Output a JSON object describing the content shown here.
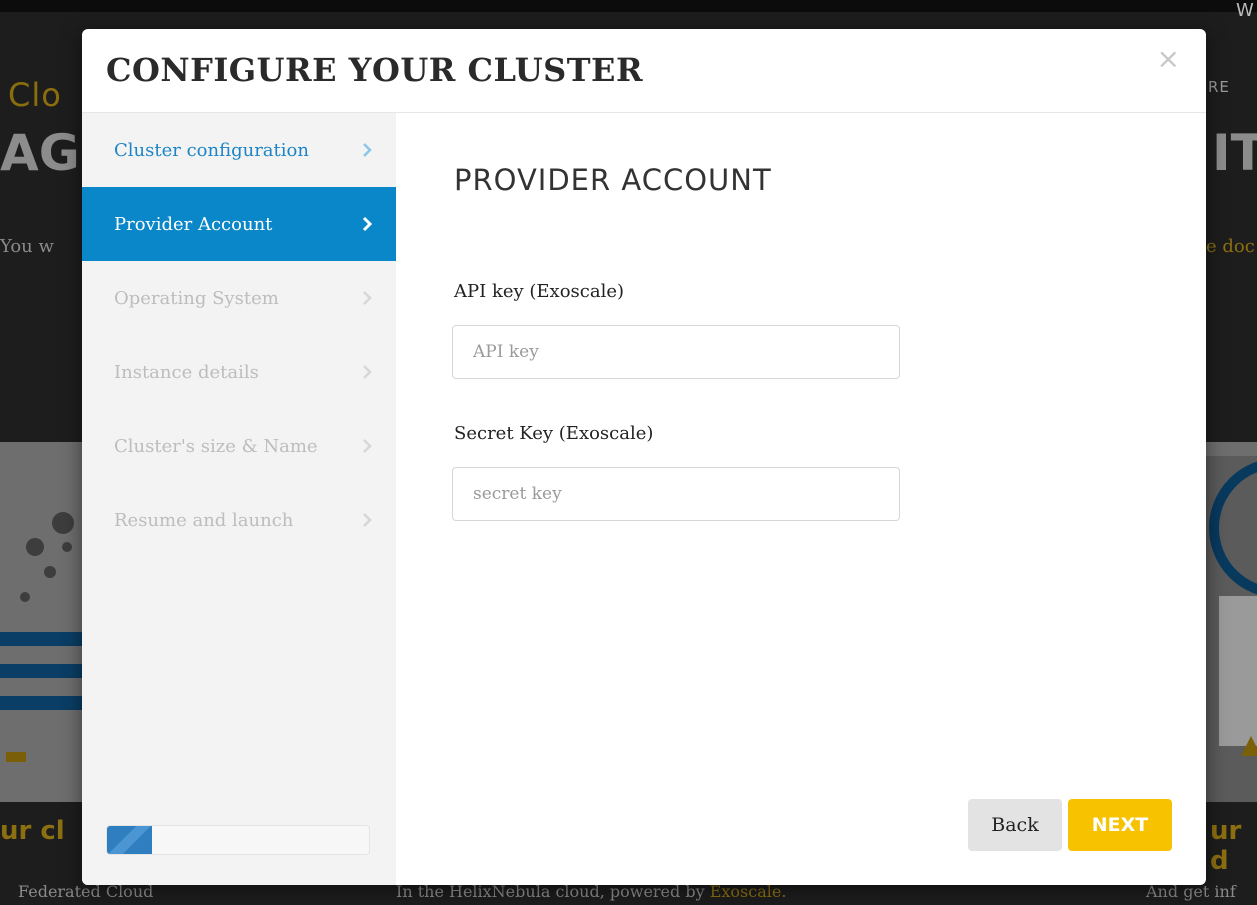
{
  "background": {
    "brand_fragment": "Clo",
    "nav_fragment_top": "W",
    "nav_fragment_right": "RE",
    "hero_left": "AG",
    "hero_right": "IT",
    "para_left": "You w",
    "para_right": "e doc",
    "section_left": "ur cl",
    "section_right": "ur d",
    "footer_left": "Federated Cloud",
    "footer_center_text": "In the HelixNebula cloud, powered by ",
    "footer_center_link": "Exoscale.",
    "footer_right": "And get inf"
  },
  "modal": {
    "title": "CONFIGURE YOUR CLUSTER",
    "close_glyph": "×",
    "steps": [
      {
        "label": "Cluster configuration",
        "chevron": "›",
        "state": "done"
      },
      {
        "label": "Provider Account",
        "chevron": "›",
        "state": "active"
      },
      {
        "label": "Operating System",
        "chevron": "›",
        "state": "pending"
      },
      {
        "label": "Instance details",
        "chevron": "›",
        "state": "pending"
      },
      {
        "label": "Cluster's size & Name",
        "chevron": "›",
        "state": "pending"
      },
      {
        "label": "Resume and launch",
        "chevron": "›",
        "state": "pending"
      }
    ],
    "progress_fraction": 0.17,
    "section_title": "PROVIDER ACCOUNT",
    "fields": {
      "api_key": {
        "label": "API key (Exoscale)",
        "placeholder": "API key",
        "value": ""
      },
      "secret_key": {
        "label": "Secret Key (Exoscale)",
        "placeholder": "secret key",
        "value": ""
      }
    },
    "buttons": {
      "back": "Back",
      "next": "NEXT"
    }
  },
  "colors": {
    "accent_blue": "#0a87c8",
    "next_yellow": "#f7c200",
    "done_blue": "#1d85c6"
  }
}
